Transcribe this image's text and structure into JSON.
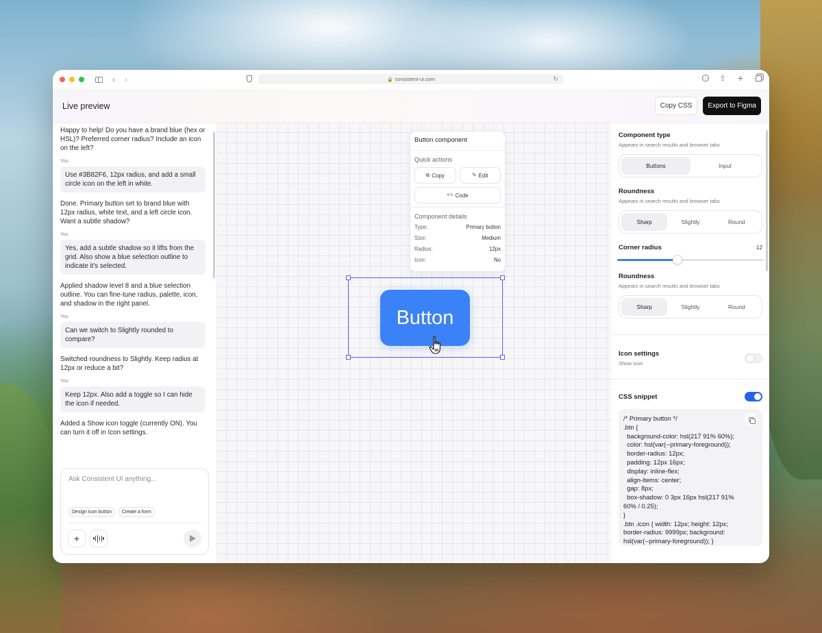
{
  "browser": {
    "url": "consistent-ui.com"
  },
  "header": {
    "title": "Live preview",
    "copy_css_label": "Copy CSS",
    "export_label": "Export to Figma"
  },
  "chat": {
    "messages": [
      {
        "role": "ai",
        "text": "Happy to help! Do you have a brand blue (hex or HSL)? Preferred corner radius? Include an icon on the left?"
      },
      {
        "role": "you",
        "label": "You",
        "text": "Use #3B82F6, 12px radius, and add a small circle icon on the left in white."
      },
      {
        "role": "ai",
        "text": "Done. Primary button set to brand blue with 12px radius, white text, and a left circle icon. Want a subtle shadow?"
      },
      {
        "role": "you",
        "label": "You",
        "text": "Yes, add a subtle shadow so it lifts from the grid. Also show a blue selection outline to indicate it's selected."
      },
      {
        "role": "ai",
        "text": "Applied shadow level 8 and a blue selection outline. You can fine-tune radius, palette, icon, and shadow in the right panel."
      },
      {
        "role": "you",
        "label": "You",
        "text": "Can we switch to Slightly rounded to compare?"
      },
      {
        "role": "ai",
        "text": "Switched roundness to Slightly. Keep radius at 12px or reduce a bit?"
      },
      {
        "role": "you",
        "label": "You",
        "text": "Keep 12px. Also add a toggle so I can hide the icon if needed."
      },
      {
        "role": "ai",
        "text": "Added a Show icon toggle (currently ON). You can turn it off in Icon settings."
      }
    ],
    "composer": {
      "placeholder": "Ask Consistent UI anything...",
      "chips": [
        "Design icon button",
        "Create a form"
      ]
    }
  },
  "canvas": {
    "popover": {
      "title": "Button component",
      "quick_actions_label": "Quick actions",
      "copy_label": "Copy",
      "edit_label": "Edit",
      "code_label": "Code",
      "details_label": "Component details",
      "details": [
        {
          "key": "Type:",
          "value": "Primary button"
        },
        {
          "key": "Size:",
          "value": "Medium"
        },
        {
          "key": "Radius:",
          "value": "12px"
        },
        {
          "key": "Icon:",
          "value": "No"
        }
      ]
    },
    "preview_button_label": "Button",
    "preview_button_color": "#3B82F6",
    "selection_color": "#6B57E8"
  },
  "settings": {
    "component_type": {
      "title": "Component type",
      "subtitle": "Appears in search results and browser tabs",
      "options": [
        "Buttons",
        "Input"
      ],
      "selected": "Buttons"
    },
    "roundness_1": {
      "title": "Roundness",
      "subtitle": "Appears in search results and browser tabs",
      "options": [
        "Sharp",
        "Slightly",
        "Round"
      ],
      "selected": "Sharp"
    },
    "corner_radius": {
      "title": "Corner radius",
      "value": "12",
      "fraction": 0.41
    },
    "roundness_2": {
      "title": "Roundness",
      "subtitle": "Appears in search results and browser tabs",
      "options": [
        "Sharp",
        "Slightly",
        "Round"
      ],
      "selected": "Sharp"
    },
    "icon_settings": {
      "title": "Icon settings",
      "subtitle": "Show icon",
      "on": false
    },
    "css_snippet": {
      "title": "CSS snippet",
      "on": true,
      "lines": [
        "/* Primary button */",
        ".btn {",
        "  background-color: hsl(217 91% 60%);",
        "  color: hsl(var(--primary-foreground));",
        "  border-radius: 12px;",
        "  padding: 12px 16px;",
        "  display: inline-flex;",
        "  align-items: center;",
        "  gap: 8px;",
        "  box-shadow: 0 3px 16px hsl(217 91%",
        "60% / 0.25);",
        "}",
        ".btn .icon { width: 12px; height: 12px;",
        "border-radius: 9999px; background:",
        "hsl(var(--primary-foreground)); }"
      ]
    }
  }
}
